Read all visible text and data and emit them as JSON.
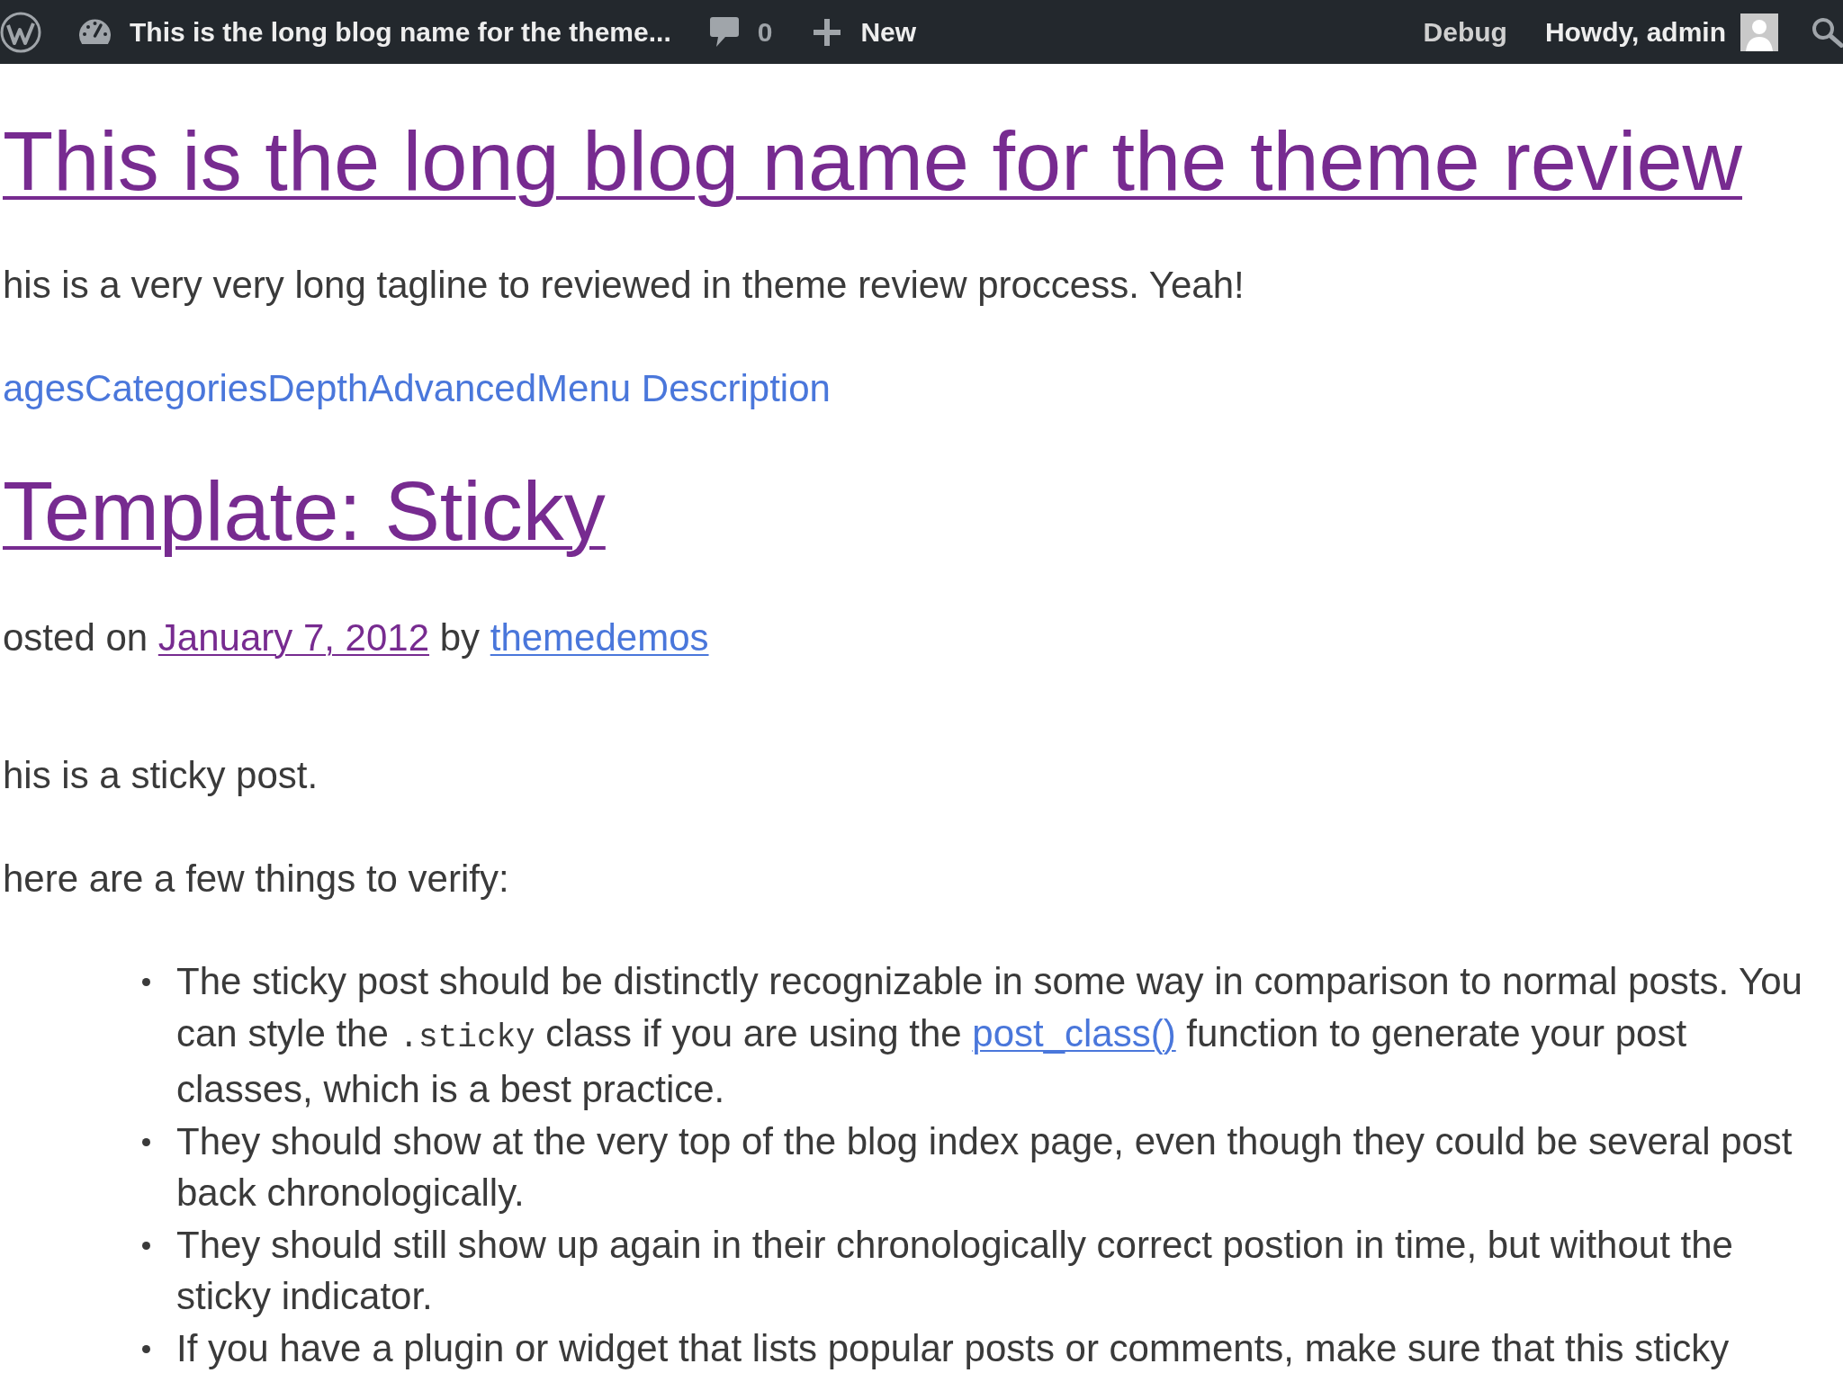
{
  "admin_bar": {
    "site_name": "This is the long blog name for the theme...",
    "comments_count": "0",
    "new_label": "New",
    "debug_label": "Debug",
    "account_label": "Howdy, admin"
  },
  "site_header": {
    "title": {
      "text": "This is the long blog name for the theme review",
      "visited": true
    },
    "tagline": "his is a very very long tagline to reviewed in theme review proccess. Yeah!"
  },
  "menu": [
    {
      "label": "ages",
      "visited": false
    },
    {
      "label": "Categories",
      "visited": false
    },
    {
      "label": "Depth",
      "visited": false
    },
    {
      "label": "Advanced",
      "visited": false
    },
    {
      "label": "Menu Description",
      "visited": false
    }
  ],
  "post": {
    "title": {
      "text": "Template: Sticky",
      "visited": true
    },
    "meta": [
      {
        "kind": "text",
        "text": "osted on "
      },
      {
        "kind": "date_link",
        "text": "January 7, 2012",
        "visited": true
      },
      {
        "kind": "text",
        "text": " by "
      },
      {
        "kind": "author_link",
        "text": "themedemos",
        "visited": false
      }
    ],
    "paragraphs": [
      "his is a sticky post.",
      "here are a few things to verify:"
    ],
    "bullets": [
      [
        {
          "kind": "text",
          "text": "The sticky post should be distinctly recognizable in some way in comparison to normal posts. You can style the "
        },
        {
          "kind": "code",
          "text": ".sticky"
        },
        {
          "kind": "text",
          "text": " class if you are using the "
        },
        {
          "kind": "link",
          "text": "post_class()",
          "visited": false
        },
        {
          "kind": "text",
          "text": " function to generate your post classes, which is a best practice."
        }
      ],
      [
        {
          "kind": "text",
          "text": "They should show at the very top of the blog index page, even though they could be several post back chronologically."
        }
      ],
      [
        {
          "kind": "text",
          "text": "They should still show up again in their chronologically correct postion in time, but without the sticky indicator."
        }
      ],
      [
        {
          "kind": "text",
          "text": "If you have a plugin or widget that lists popular posts or comments, make sure that this sticky"
        }
      ]
    ]
  }
}
